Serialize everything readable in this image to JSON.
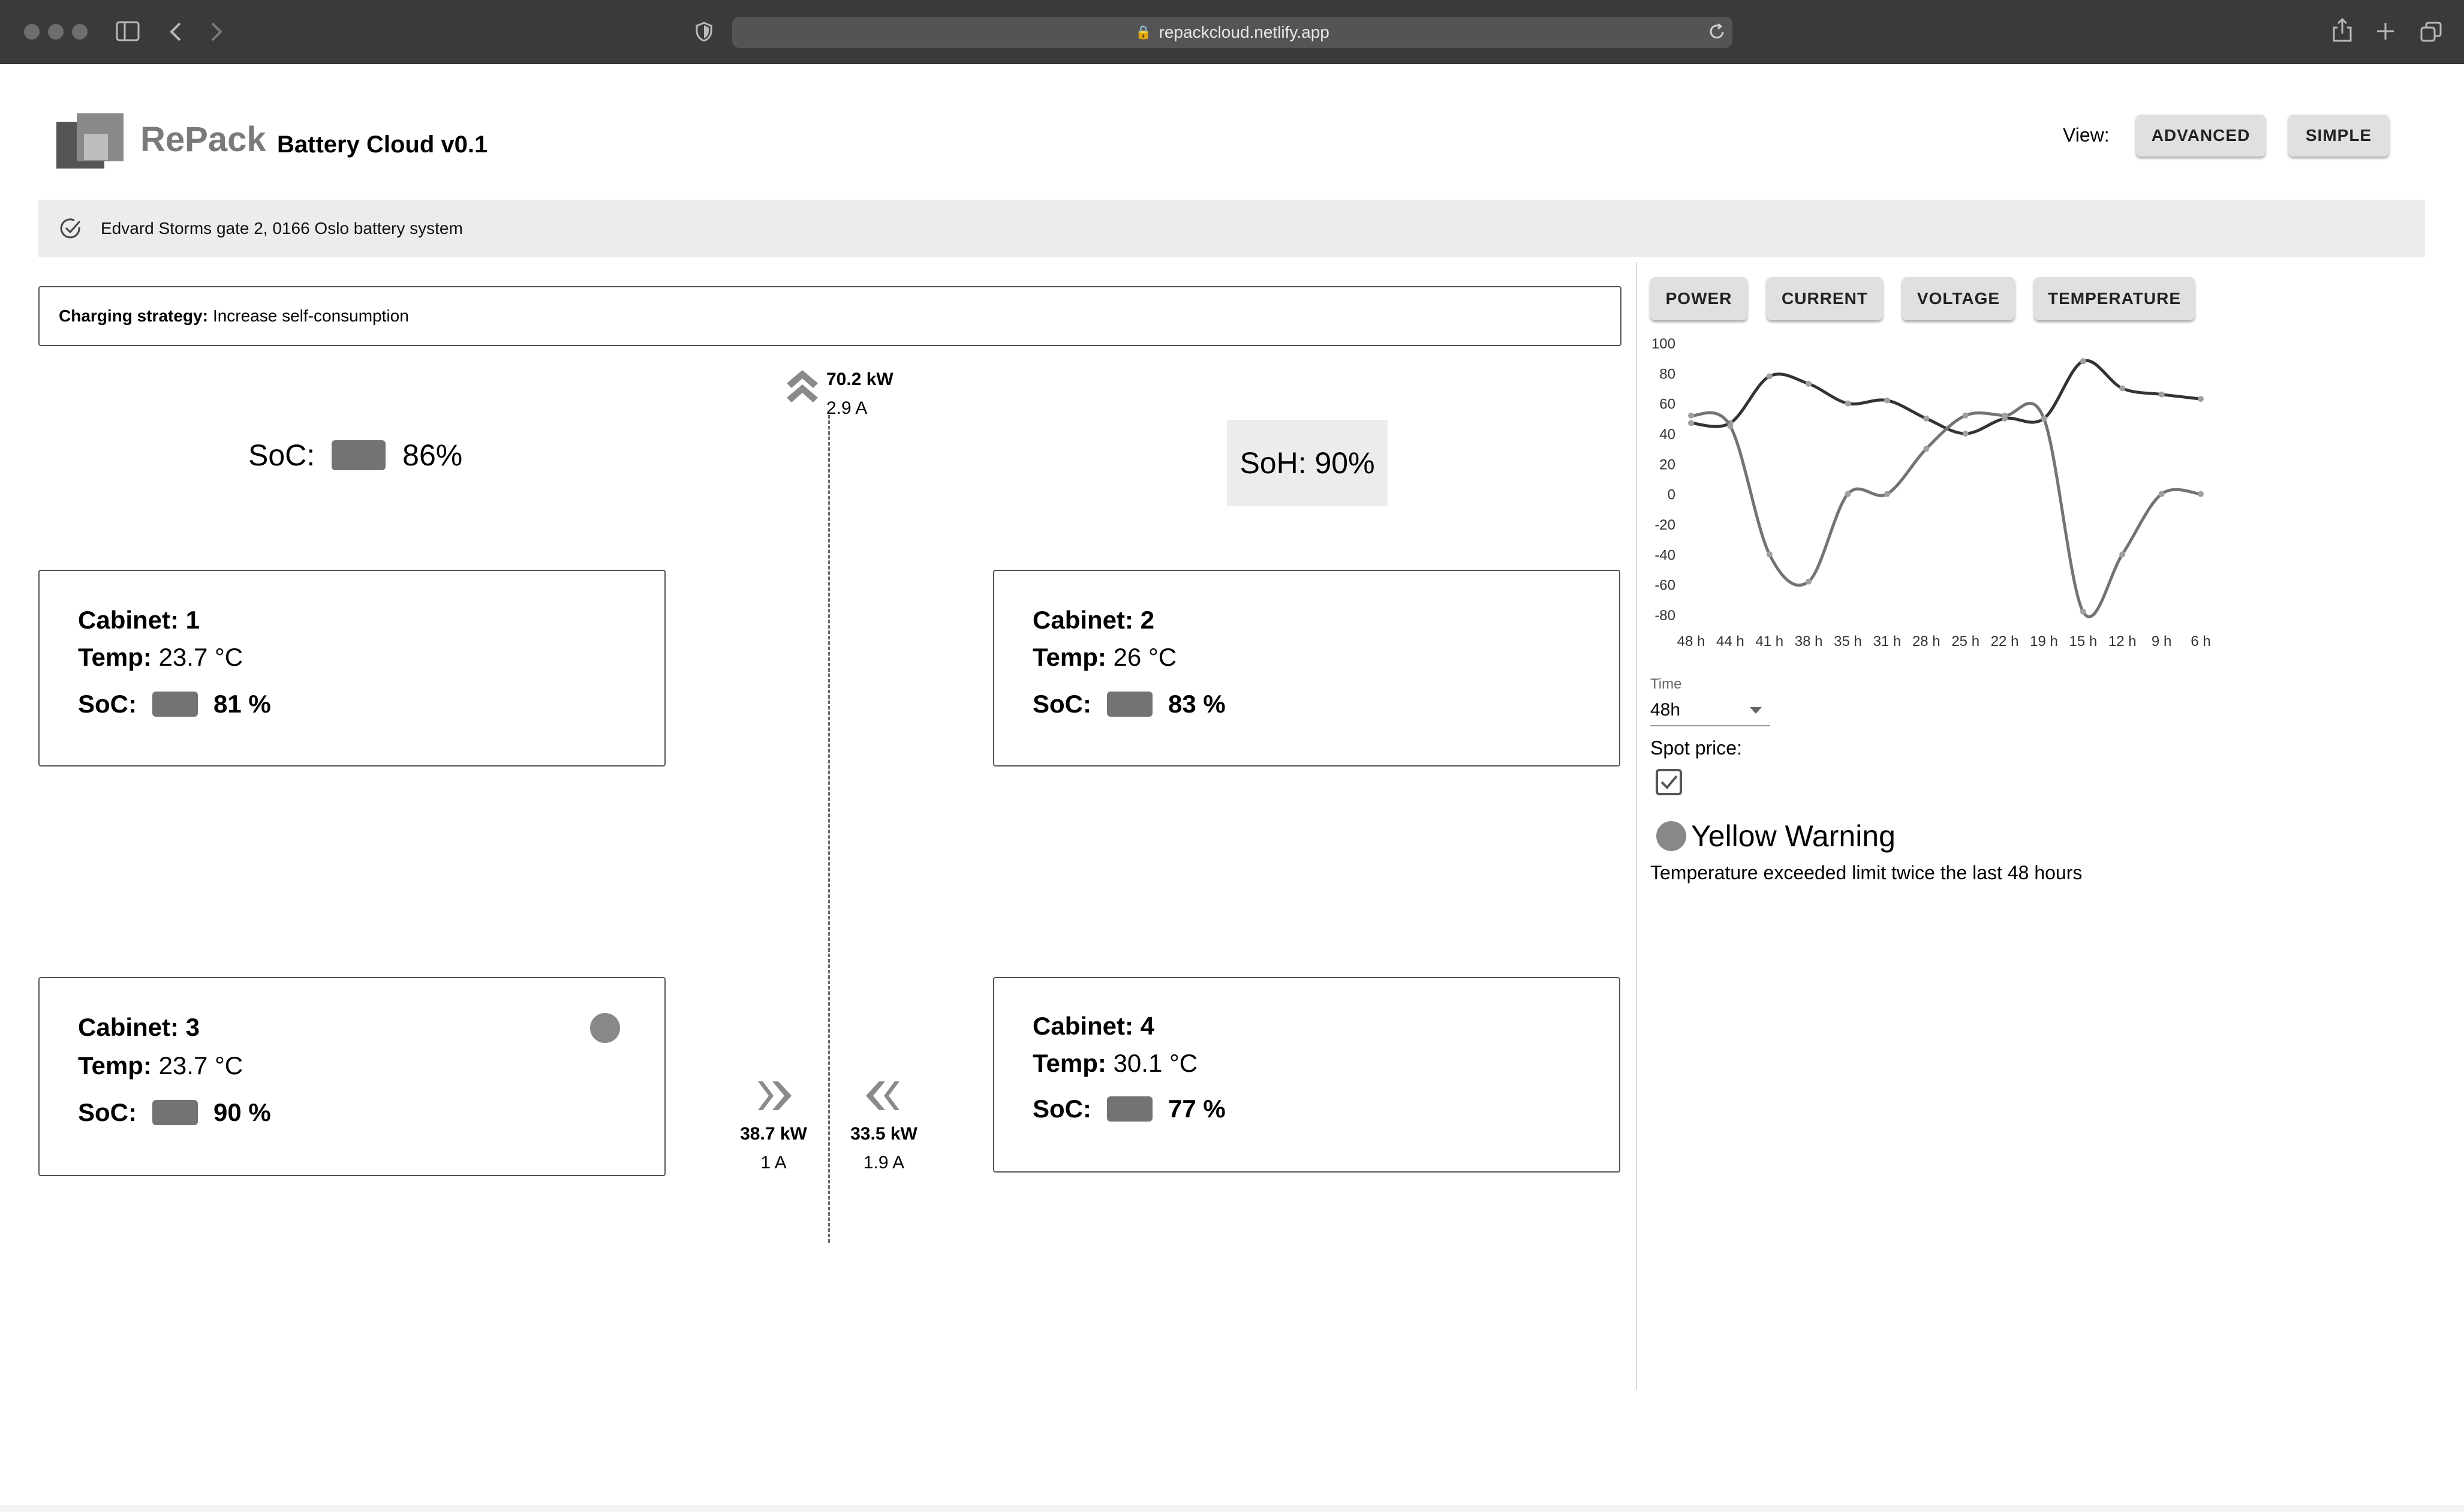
{
  "browser": {
    "url": "repackcloud.netlify.app"
  },
  "header": {
    "logo_text": "RePack",
    "app_title": "Battery Cloud v0.1",
    "view_label": "View:",
    "advanced_label": "ADVANCED",
    "simple_label": "SIMPLE"
  },
  "system": {
    "address": "Edvard Storms gate 2, 0166 Oslo battery system"
  },
  "strategy": {
    "label": "Charging strategy:",
    "value": "Increase self-consumption"
  },
  "summary": {
    "soc_label": "SoC:",
    "soc_value": "86%",
    "soh_text": "SoH: 90%"
  },
  "flows": {
    "top": {
      "kw": "70.2 kW",
      "amp": "2.9 A"
    },
    "left": {
      "kw": "38.7 kW",
      "amp": "1 A"
    },
    "right": {
      "kw": "33.5 kW",
      "amp": "1.9 A"
    }
  },
  "cabinets": [
    {
      "name": "Cabinet: 1",
      "temp_label": "Temp:",
      "temp": "23.7 °C",
      "soc_label": "SoC:",
      "soc": "81 %"
    },
    {
      "name": "Cabinet: 2",
      "temp_label": "Temp:",
      "temp": "26 °C",
      "soc_label": "SoC:",
      "soc": "83 %"
    },
    {
      "name": "Cabinet: 3",
      "temp_label": "Temp:",
      "temp": "23.7 °C",
      "soc_label": "SoC:",
      "soc": "90 %"
    },
    {
      "name": "Cabinet: 4",
      "temp_label": "Temp:",
      "temp": "30.1 °C",
      "soc_label": "SoC:",
      "soc": "77 %"
    }
  ],
  "tabs": [
    "POWER",
    "CURRENT",
    "VOLTAGE",
    "TEMPERATURE"
  ],
  "controls": {
    "time_label": "Time",
    "time_value": "48h",
    "spot_label": "Spot price:",
    "spot_checked": true
  },
  "warning": {
    "title": "Yellow Warning",
    "text": "Temperature exceeded limit twice the last 48 hours"
  },
  "colors": {
    "series_dark": "#333333",
    "series_light": "#737373",
    "button_bg": "#e0e0e0",
    "status_dot": "#888888"
  },
  "chart_data": {
    "type": "line",
    "title": "",
    "xlabel": "",
    "ylabel": "",
    "categories": [
      "48 h",
      "44 h",
      "41 h",
      "38 h",
      "35 h",
      "31 h",
      "28 h",
      "25 h",
      "22 h",
      "19 h",
      "15 h",
      "12 h",
      "9 h",
      "6 h"
    ],
    "ylim": [
      -80,
      100
    ],
    "yticks": [
      100,
      80,
      60,
      40,
      20,
      0,
      -20,
      -40,
      -60,
      -80
    ],
    "series": [
      {
        "color": "#333333",
        "values": [
          47,
          47,
          78,
          73,
          60,
          62,
          50,
          40,
          50,
          50,
          88,
          70,
          66,
          63
        ]
      },
      {
        "color": "#737373",
        "values": [
          52,
          45,
          -40,
          -58,
          0,
          0,
          30,
          52,
          52,
          50,
          -78,
          -40,
          0,
          0
        ]
      }
    ],
    "grid": false,
    "legend": "none"
  }
}
